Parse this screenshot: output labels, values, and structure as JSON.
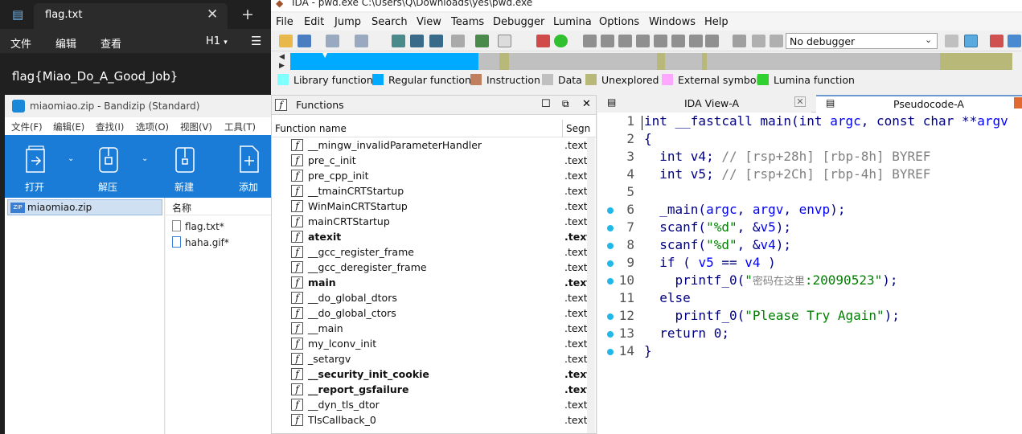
{
  "notepad": {
    "tab_title": "flag.txt",
    "menu": [
      "文件",
      "编辑",
      "查看"
    ],
    "heading_select": "H1",
    "content": "flag{Miao_Do_A_Good_Job}"
  },
  "bandizip": {
    "title": "miaomiao.zip - Bandizip (Standard)",
    "menu": [
      "文件(F)",
      "编辑(E)",
      "查找(I)",
      "选项(O)",
      "视图(V)",
      "工具(T)"
    ],
    "toolbar": [
      "打开",
      "解压",
      "新建",
      "添加"
    ],
    "tree_item": "miaomiao.zip",
    "zip_badge": "ZIP",
    "column_name": "名称",
    "files": [
      "flag.txt*",
      "haha.gif*"
    ]
  },
  "ida": {
    "title": "IDA - pwd.exe C:\\Users\\Q\\Downloads\\yes\\pwd.exe",
    "menu": [
      "File",
      "Edit",
      "Jump",
      "Search",
      "View",
      "Teams",
      "Debugger",
      "Lumina",
      "Options",
      "Windows",
      "Help"
    ],
    "debugger_select": "No debugger",
    "legend": [
      {
        "label": "Library function",
        "color": "#80ffff"
      },
      {
        "label": "Regular function",
        "color": "#00aaff"
      },
      {
        "label": "Instruction",
        "color": "#c08060"
      },
      {
        "label": "Data",
        "color": "#c0c0c0"
      },
      {
        "label": "Unexplored",
        "color": "#b8b878"
      },
      {
        "label": "External symbol",
        "color": "#ffa8ff"
      },
      {
        "label": "Lumina function",
        "color": "#30d030"
      }
    ],
    "functions_panel": {
      "title": "Functions",
      "col_name": "Function name",
      "col_segment": "Segn",
      "rows": [
        {
          "name": "__mingw_invalidParameterHandler",
          "seg": ".text",
          "bold": false
        },
        {
          "name": "pre_c_init",
          "seg": ".text",
          "bold": false
        },
        {
          "name": "pre_cpp_init",
          "seg": ".text",
          "bold": false
        },
        {
          "name": "__tmainCRTStartup",
          "seg": ".text",
          "bold": false
        },
        {
          "name": "WinMainCRTStartup",
          "seg": ".text",
          "bold": false
        },
        {
          "name": "mainCRTStartup",
          "seg": ".text",
          "bold": false
        },
        {
          "name": "atexit",
          "seg": ".text",
          "bold": true
        },
        {
          "name": "__gcc_register_frame",
          "seg": ".text",
          "bold": false
        },
        {
          "name": "__gcc_deregister_frame",
          "seg": ".text",
          "bold": false
        },
        {
          "name": "main",
          "seg": ".text",
          "bold": true
        },
        {
          "name": "__do_global_dtors",
          "seg": ".text",
          "bold": false
        },
        {
          "name": "__do_global_ctors",
          "seg": ".text",
          "bold": false
        },
        {
          "name": "__main",
          "seg": ".text",
          "bold": false
        },
        {
          "name": "my_lconv_init",
          "seg": ".text",
          "bold": false
        },
        {
          "name": "_setargv",
          "seg": ".text",
          "bold": false
        },
        {
          "name": "__security_init_cookie",
          "seg": ".text",
          "bold": true
        },
        {
          "name": "__report_gsfailure",
          "seg": ".text",
          "bold": true
        },
        {
          "name": "__dyn_tls_dtor",
          "seg": ".text",
          "bold": false
        },
        {
          "name": "TlsCallback_0",
          "seg": ".text",
          "bold": false
        }
      ]
    },
    "tabs": [
      "IDA View-A",
      "Pseudocode-A"
    ],
    "pseudocode": [
      {
        "n": "1",
        "dot": false,
        "text": "int __fastcall main(int argc, const char **argv"
      },
      {
        "n": "2",
        "dot": false,
        "text": "{"
      },
      {
        "n": "3",
        "dot": false,
        "text": "  int v4; // [rsp+28h] [rbp-8h] BYREF"
      },
      {
        "n": "4",
        "dot": false,
        "text": "  int v5; // [rsp+2Ch] [rbp-4h] BYREF"
      },
      {
        "n": "5",
        "dot": false,
        "text": ""
      },
      {
        "n": "6",
        "dot": true,
        "text": "  _main(argc, argv, envp);"
      },
      {
        "n": "7",
        "dot": true,
        "text": "  scanf(\"%d\", &v5);"
      },
      {
        "n": "8",
        "dot": true,
        "text": "  scanf(\"%d\", &v4);"
      },
      {
        "n": "9",
        "dot": true,
        "text": "  if ( v5 == v4 )"
      },
      {
        "n": "10",
        "dot": true,
        "text": "    printf_0(\"密码在这里:20090523\");"
      },
      {
        "n": "11",
        "dot": false,
        "text": "  else"
      },
      {
        "n": "12",
        "dot": true,
        "text": "    printf_0(\"Please Try Again\");"
      },
      {
        "n": "13",
        "dot": true,
        "text": "  return 0;"
      },
      {
        "n": "14",
        "dot": true,
        "text": "}"
      }
    ]
  }
}
